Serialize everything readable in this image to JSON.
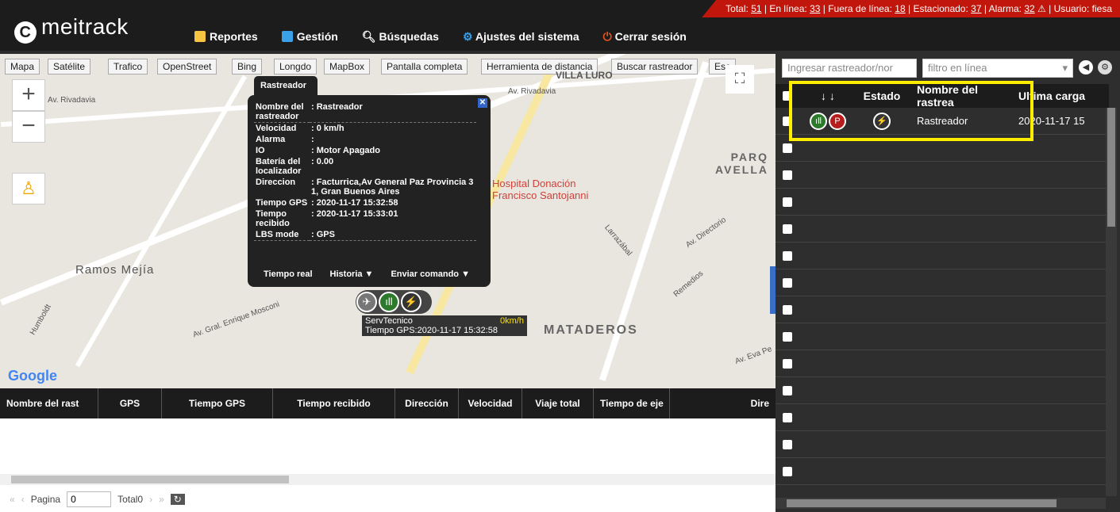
{
  "header": {
    "logo": "meitrack",
    "stats": {
      "total_label": "Total:",
      "total": "51",
      "online_label": "En línea:",
      "online": "33",
      "offline_label": "Fuera de línea:",
      "offline": "18",
      "parked_label": "Estacionado:",
      "parked": "37",
      "alarm_label": "Alarma:",
      "alarm": "32",
      "user_label": "Usuario:",
      "user": "fiesa"
    },
    "nav": [
      {
        "label": "Reportes",
        "icon": "report-icon",
        "color": "#f5c542"
      },
      {
        "label": "Gestión",
        "icon": "management-icon",
        "color": "#3aa0e8"
      },
      {
        "label": "Búsquedas",
        "icon": "search-icon",
        "color": "#ffffff"
      },
      {
        "label": "Ajustes del sistema",
        "icon": "gear-icon",
        "color": "#3aa0e8"
      },
      {
        "label": "Cerrar sesión",
        "icon": "power-icon",
        "color": "#e8531f"
      }
    ]
  },
  "map": {
    "tabs": [
      "Mapa",
      "Satélite",
      "Trafico",
      "OpenStreet",
      "Bing",
      "Longdo",
      "MapBox",
      "Pantalla completa",
      "Herramienta de distancia",
      "Buscar rastreador",
      "Esc"
    ],
    "places": [
      "Ramos Mejía",
      "MATADEROS",
      "PARQ AVELLA",
      "Hospital Donación Francisco Santojanni",
      "VILLA LURO",
      "Av. Rivadavia",
      "Av. Rivadavia",
      "Av. Directorio",
      "Av. Gral. Enrique Mosconi",
      "Humboldt",
      "Remedios",
      "Larrazábal",
      "Av. Eva Pe"
    ],
    "google": "Google",
    "popup": {
      "tab": "Rastreador",
      "rows": [
        {
          "k": "Nombre del rastreador",
          "v": "Rastreador"
        },
        {
          "k": "Velocidad",
          "v": "0 km/h"
        },
        {
          "k": "Alarma",
          "v": ""
        },
        {
          "k": "IO",
          "v": "Motor Apagado"
        },
        {
          "k": "Batería del localizador",
          "v": "0.00"
        },
        {
          "k": "Direccion",
          "v": "Facturrica,Av General Paz Provincia 3 1, Gran Buenos Aires"
        },
        {
          "k": "Tiempo GPS",
          "v": "2020-11-17 15:32:58"
        },
        {
          "k": "Tiempo recibido",
          "v": "2020-11-17 15:33:01"
        },
        {
          "k": "LBS mode",
          "v": "GPS"
        }
      ],
      "actions": [
        "Tiempo real",
        "Historia ▼",
        "Enviar comando ▼"
      ]
    },
    "marker_label": {
      "name": "ServTecnico",
      "speed": "0km/h",
      "time": "Tiempo GPS:2020-11-17 15:32:58"
    }
  },
  "grid": {
    "columns": [
      "Nombre del rast",
      "GPS",
      "Tiempo GPS",
      "Tiempo recibido",
      "Dirección",
      "Velocidad",
      "Viaje total",
      "Tiempo de eje",
      "Dire"
    ]
  },
  "pager": {
    "label": "Pagina",
    "page": "0",
    "total": "Total0"
  },
  "right": {
    "search_placeholder": "Ingresar rastreador/nor",
    "filter": "filtro en línea",
    "columns": [
      "",
      "",
      "Estado",
      "Nombre del rastrea",
      "Ultima carga"
    ],
    "rows": [
      {
        "name": "Rastreador",
        "last": "2020-11-17 15"
      }
    ]
  }
}
